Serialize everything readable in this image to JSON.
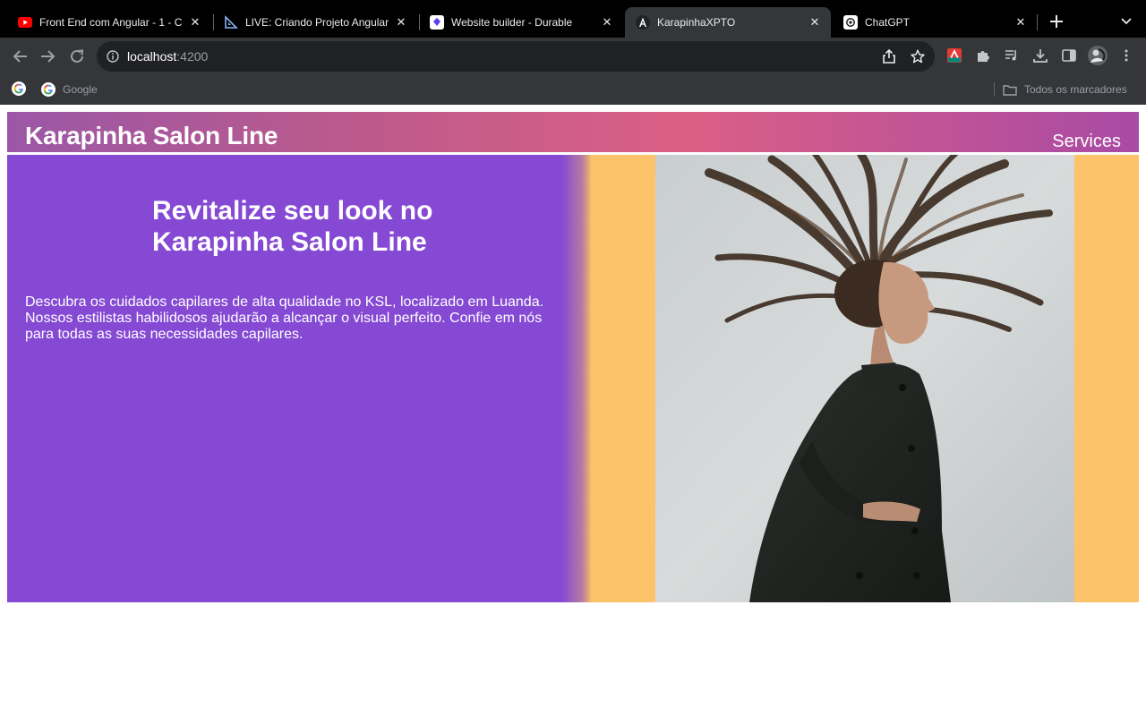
{
  "browser": {
    "tabs": [
      {
        "title": "Front End com Angular - 1 - C",
        "favicon": "youtube-icon",
        "active": false
      },
      {
        "title": "LIVE: Criando Projeto Angular",
        "favicon": "set-square-icon",
        "active": false
      },
      {
        "title": "Website builder - Durable",
        "favicon": "durable-icon",
        "active": false
      },
      {
        "title": "KarapinhaXPTO",
        "favicon": "angular-icon",
        "active": true
      },
      {
        "title": "ChatGPT",
        "favicon": "chatgpt-icon",
        "active": false
      }
    ],
    "url": {
      "host": "localhost",
      "port": ":4200"
    },
    "bookmarks": {
      "google_label": "Google",
      "all_bookmarks_label": "Todos os marcadores"
    }
  },
  "site": {
    "brand": "Karapinha Salon Line",
    "nav": {
      "services": "Services"
    },
    "hero": {
      "title": "Revitalize seu look no Karapinha Salon Line",
      "description": "Descubra os cuidados capilares de alta qualidade no KSL, localizado em Luanda. Nossos estilistas habilidosos ajudarão a alcançar o visual perfeito. Confie em nós para todas as suas necessidades capilares.",
      "image": "woman-with-flowing-hair-photo"
    }
  },
  "colors": {
    "hero_left": "#8549d4",
    "hero_right": "#fdc36b",
    "header_gradient_start": "#9b57a6",
    "header_gradient_mid": "#db5f85",
    "header_gradient_end": "#a94aa4",
    "browser_tabstrip": "#000000",
    "browser_toolbar": "#35363a"
  }
}
